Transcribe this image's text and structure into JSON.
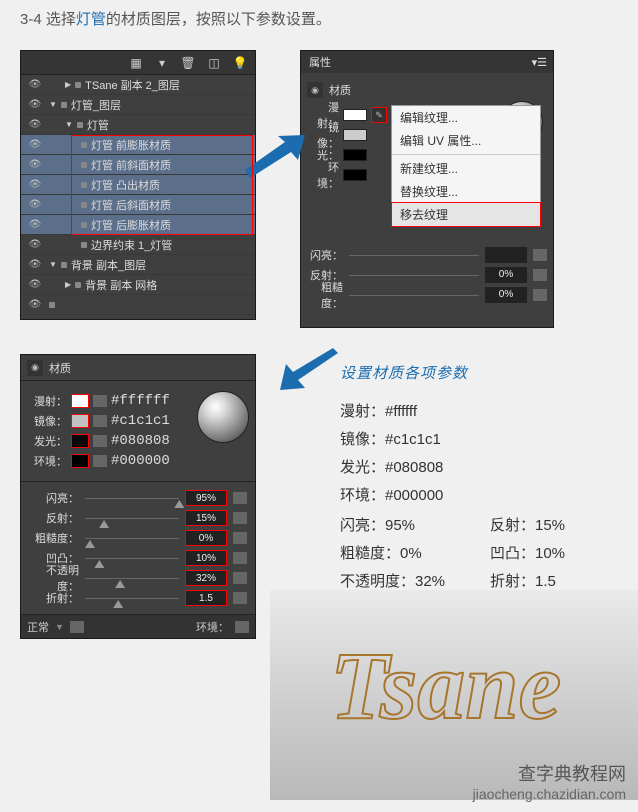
{
  "instruction": {
    "prefix": "3-4 选择",
    "highlight": "灯管",
    "suffix": "的材质图层，按照以下参数设置。"
  },
  "layers_panel": {
    "rows": [
      {
        "indent": 1,
        "toggle": "▶",
        "label": "TSane 副本 2_图层",
        "selected": false,
        "eye": true
      },
      {
        "indent": 0,
        "toggle": "▼",
        "label": "灯管_图层",
        "selected": false,
        "eye": true
      },
      {
        "indent": 1,
        "toggle": "▼",
        "label": "灯管",
        "selected": false,
        "eye": true
      },
      {
        "indent": 2,
        "toggle": "",
        "label": "灯管 前膨胀材质",
        "selected": true,
        "eye": true
      },
      {
        "indent": 2,
        "toggle": "",
        "label": "灯管 前斜面材质",
        "selected": true,
        "eye": true
      },
      {
        "indent": 2,
        "toggle": "",
        "label": "灯管 凸出材质",
        "selected": true,
        "eye": true
      },
      {
        "indent": 2,
        "toggle": "",
        "label": "灯管 后斜面材质",
        "selected": true,
        "eye": true
      },
      {
        "indent": 2,
        "toggle": "",
        "label": "灯管 后膨胀材质",
        "selected": true,
        "eye": true
      },
      {
        "indent": 2,
        "toggle": "",
        "label": "边界约束 1_灯管",
        "selected": false,
        "eye": true
      },
      {
        "indent": 0,
        "toggle": "▼",
        "label": "背景 副本_图层",
        "selected": false,
        "eye": true
      },
      {
        "indent": 1,
        "toggle": "▶",
        "label": "背景 副本 网格",
        "selected": false,
        "eye": true
      },
      {
        "indent": 0,
        "toggle": "",
        "label": "",
        "selected": false,
        "eye": true
      }
    ]
  },
  "properties_panel": {
    "tab": "属性",
    "section": "材质",
    "rows_left": [
      "漫射：",
      "镜像：",
      "光：",
      "环境："
    ],
    "sliders": [
      {
        "label": "闪亮：",
        "val": ""
      },
      {
        "label": "反射：",
        "val": "0%"
      },
      {
        "label": "粗糙度：",
        "val": "0%"
      }
    ]
  },
  "context_menu": {
    "items": [
      {
        "label": "编辑纹理...",
        "sep": false
      },
      {
        "label": "编辑 UV 属性...",
        "sep": true
      },
      {
        "label": "新建纹理...",
        "sep": false
      },
      {
        "label": "替换纹理...",
        "sep": false
      },
      {
        "label": "移去纹理",
        "sep": false,
        "highlighted": true
      }
    ]
  },
  "material_panel": {
    "section": "材质",
    "params": [
      {
        "label": "漫射：",
        "hex": "#ffffff",
        "swatch": "#ffffff"
      },
      {
        "label": "镜像：",
        "hex": "#c1c1c1",
        "swatch": "#c1c1c1"
      },
      {
        "label": "发光：",
        "hex": "#080808",
        "swatch": "#080808"
      },
      {
        "label": "环境：",
        "hex": "#000000",
        "swatch": "#000000"
      }
    ],
    "sliders": [
      {
        "label": "闪亮：",
        "val": "95%",
        "pos": 95
      },
      {
        "label": "反射：",
        "val": "15%",
        "pos": 15
      },
      {
        "label": "粗糙度：",
        "val": "0%",
        "pos": 0
      },
      {
        "label": "凹凸：",
        "val": "10%",
        "pos": 10
      },
      {
        "label": "不透明度：",
        "val": "32%",
        "pos": 32
      },
      {
        "label": "折射：",
        "val": "1.5",
        "pos": 30
      }
    ],
    "footer_left": "正常",
    "footer_right": "环境："
  },
  "params_text": {
    "title": "设置材质各项参数",
    "lines": [
      "漫射：#ffffff",
      "镜像：#c1c1c1",
      "发光：#080808",
      "环境：#000000"
    ],
    "two_col": [
      [
        "闪亮：95%",
        "反射：15%"
      ],
      [
        "粗糙度：0%",
        "凹凸：10%"
      ],
      [
        "不透明度：32%",
        "折射：1.5"
      ]
    ]
  },
  "tsane_text": "Tsane",
  "watermark": {
    "cn": "查字典教程网",
    "url": "jiaocheng.chazidian.com"
  }
}
